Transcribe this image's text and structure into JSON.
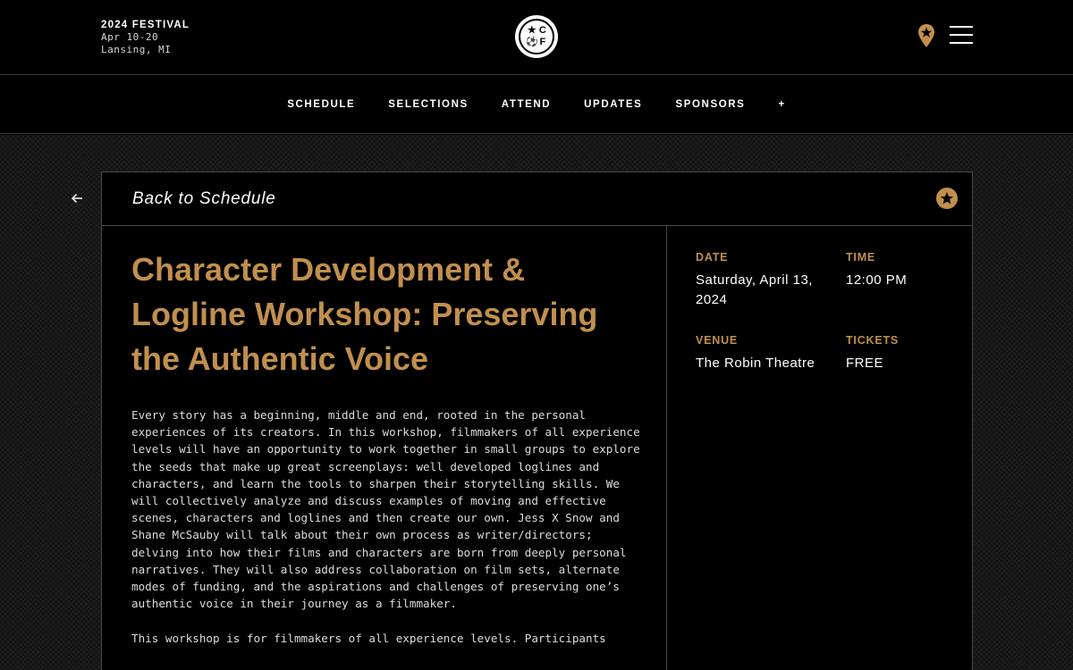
{
  "header": {
    "festival_title": "2024 FESTIVAL",
    "dates": "Apr 10-20",
    "location": "Lansing, MI",
    "logo": {
      "tl": "★",
      "tr": "C",
      "bl": "⚽",
      "br": "F"
    },
    "icons": {
      "location": "map-pin-icon",
      "menu": "hamburger-menu-icon"
    },
    "accent_color": "#c18f4e"
  },
  "nav": {
    "items": [
      "SCHEDULE",
      "SELECTIONS",
      "ATTEND",
      "UPDATES",
      "SPONSORS",
      "+"
    ]
  },
  "card": {
    "back_label": "Back to Schedule",
    "title": "Character Development & Logline Workshop: Preserving the Authentic Voice",
    "description": [
      "Every story has a beginning, middle and end, rooted in the personal experiences of its creators. In this workshop, filmmakers of all experience levels will have an opportunity to work together in small groups to explore the seeds that make up great screenplays: well developed loglines and characters, and learn the tools to sharpen their storytelling skills. We will collectively analyze and discuss examples of moving and effective scenes, characters and loglines and then create our own. Jess X Snow and Shane McSauby will talk about their own process as writer/directors; delving into how their films and characters are born from deeply personal narratives. They will also address collaboration on film sets, alternate modes of funding, and the aspirations and challenges of preserving one’s authentic voice in their journey as a filmmaker.",
      "This workshop is for filmmakers of all experience levels. Participants"
    ],
    "meta": {
      "date_label": "DATE",
      "date_value": "Saturday, April 13, 2024",
      "time_label": "TIME",
      "time_value": "12:00 PM",
      "venue_label": "VENUE",
      "venue_value": "The Robin Theatre",
      "tickets_label": "TICKETS",
      "tickets_value": "FREE"
    }
  }
}
